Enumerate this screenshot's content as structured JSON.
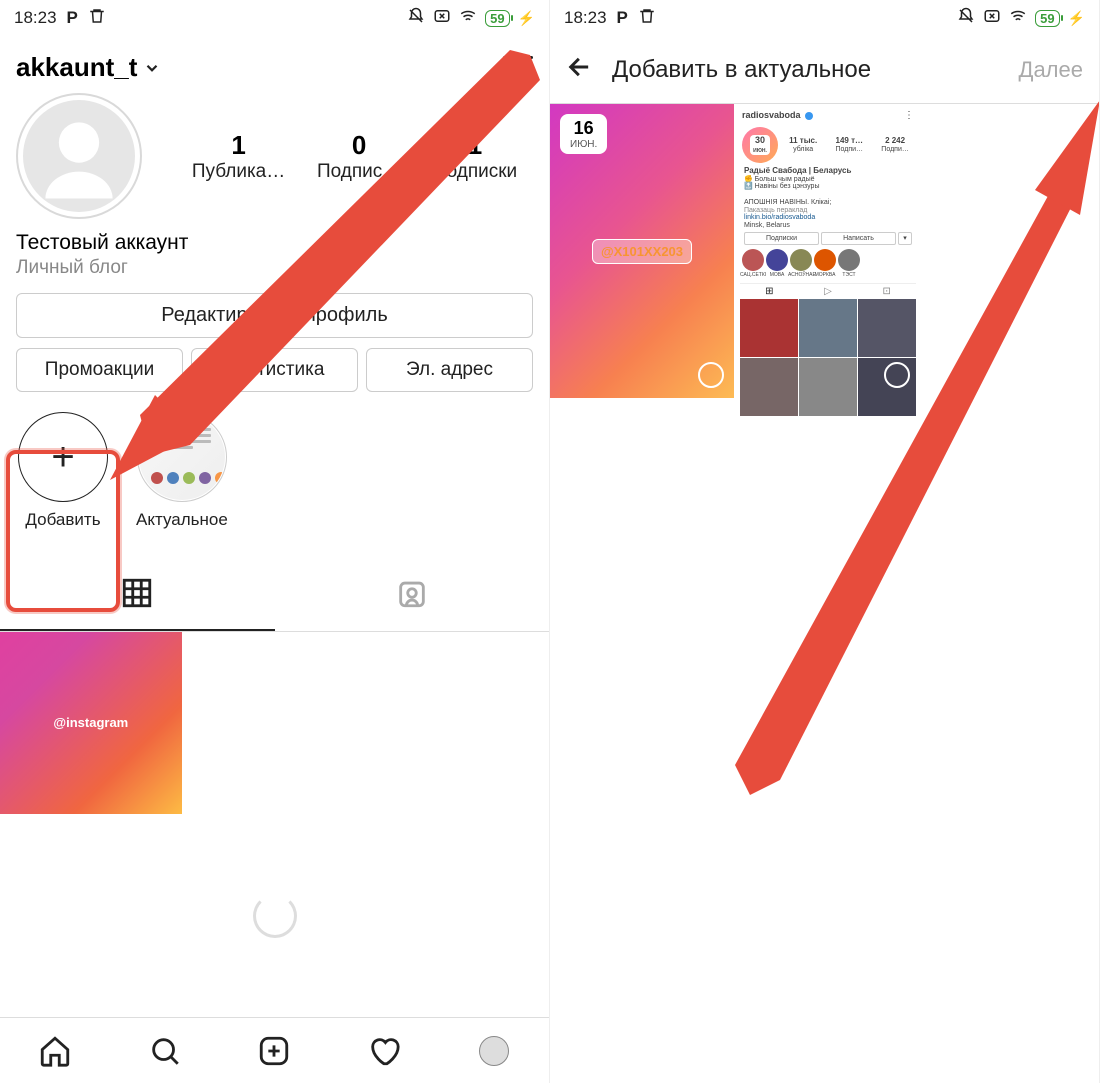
{
  "status": {
    "time": "18:23",
    "battery": "59"
  },
  "left": {
    "username": "akkaunt_t",
    "stats": {
      "posts_num": "1",
      "posts_lbl": "Публика…",
      "followers_num": "0",
      "followers_lbl": "Подпис…",
      "following_num": "1",
      "following_lbl": "Подписки"
    },
    "bio_name": "Тестовый аккаунт",
    "bio_sub": "Личный блог",
    "edit_btn": "Редактировать профиль",
    "promo_btn": "Промоакции",
    "stats_btn": "Статистика",
    "email_btn": "Эл. адрес",
    "hl_add": "Добавить",
    "hl_actual": "Актуальное",
    "post_tag": "@instagram"
  },
  "right": {
    "title": "Добавить в актуальное",
    "next": "Далее",
    "story1": {
      "date_num": "16",
      "date_mon": "июн.",
      "mention": "@X101XX203"
    },
    "story2": {
      "name": "radiosvaboda",
      "date_num": "30",
      "date_mon": "ИЮН.",
      "s1n": "11 тыс.",
      "s1l": "убліка",
      "s2n": "149 т…",
      "s2l": "Подпи…",
      "s3n": "2 242",
      "s3l": "Подпи…",
      "bio_name": "Радыё Свабода | Беларусь",
      "bio1": "✊ Больш чым радыё",
      "bio2": "🔝 Навіны без цэнзуры",
      "bio3": "АПОШНІЯ НАВІНЫ. Клікаі;",
      "bio4": "Паказаць пераклад",
      "bio5": "linkin.bio/radiosvaboda",
      "bio6": "Minsk, Belarus",
      "b1": "Подписки",
      "b2": "Написать",
      "h1": "САЦ.СЕТКІ",
      "h2": "МОВА",
      "h3": "АСНОЎНАЕ",
      "h4": "МОРКВА",
      "h5": "ТЭСТ"
    }
  }
}
